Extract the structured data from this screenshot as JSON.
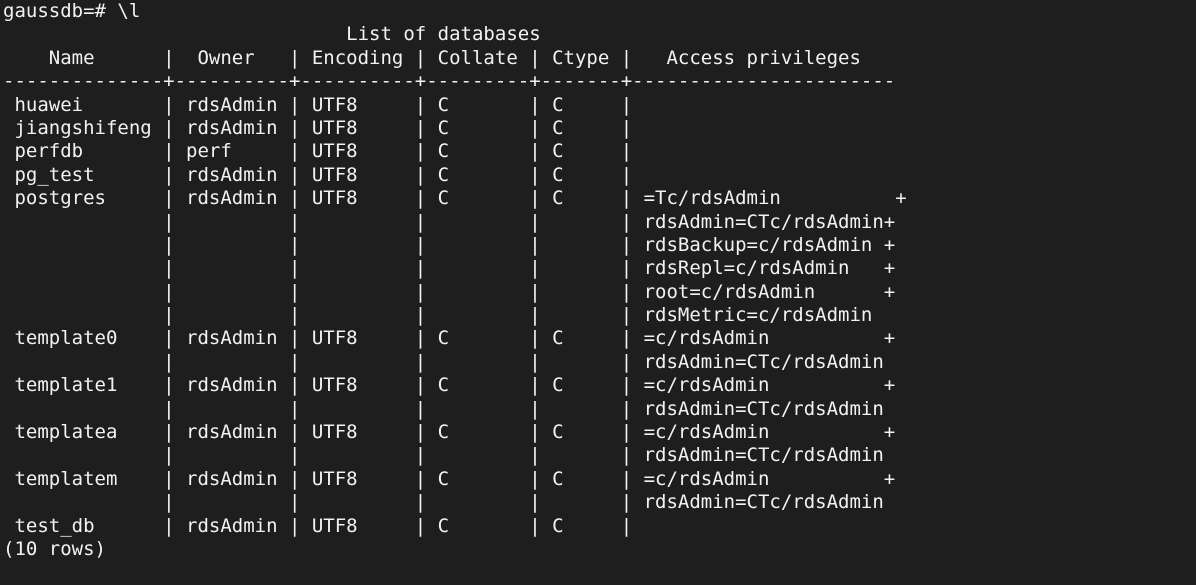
{
  "terminal": {
    "lines": [
      "gaussdb=# \\l",
      "                              List of databases",
      "    Name      |  Owner   | Encoding | Collate | Ctype |   Access privileges",
      "--------------+----------+----------+---------+-------+-----------------------",
      " huawei       | rdsAdmin | UTF8     | C       | C     |",
      " jiangshifeng | rdsAdmin | UTF8     | C       | C     |",
      " perfdb       | perf     | UTF8     | C       | C     |",
      " pg_test      | rdsAdmin | UTF8     | C       | C     |",
      " postgres     | rdsAdmin | UTF8     | C       | C     | =Tc/rdsAdmin          +",
      "              |          |          |         |       | rdsAdmin=CTc/rdsAdmin+",
      "              |          |          |         |       | rdsBackup=c/rdsAdmin +",
      "              |          |          |         |       | rdsRepl=c/rdsAdmin   +",
      "              |          |          |         |       | root=c/rdsAdmin      +",
      "              |          |          |         |       | rdsMetric=c/rdsAdmin",
      " template0    | rdsAdmin | UTF8     | C       | C     | =c/rdsAdmin          +",
      "              |          |          |         |       | rdsAdmin=CTc/rdsAdmin",
      " template1    | rdsAdmin | UTF8     | C       | C     | =c/rdsAdmin          +",
      "              |          |          |         |       | rdsAdmin=CTc/rdsAdmin",
      " templatea    | rdsAdmin | UTF8     | C       | C     | =c/rdsAdmin          +",
      "              |          |          |         |       | rdsAdmin=CTc/rdsAdmin",
      " templatem    | rdsAdmin | UTF8     | C       | C     | =c/rdsAdmin          +",
      "              |          |          |         |       | rdsAdmin=CTc/rdsAdmin",
      " test_db      | rdsAdmin | UTF8     | C       | C     |",
      "(10 rows)",
      ""
    ]
  },
  "colors": {
    "background": "#1e1e1e",
    "foreground": "#f2f2f2"
  }
}
